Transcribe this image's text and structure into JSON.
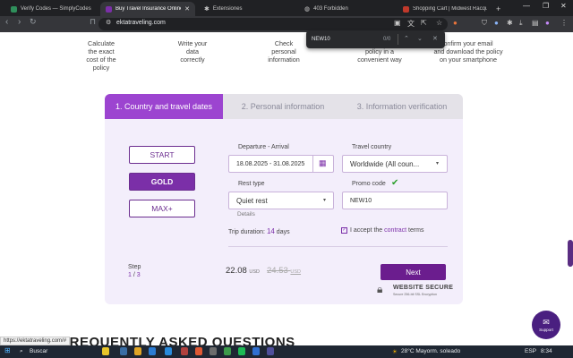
{
  "browser": {
    "tabs": [
      {
        "label": "Verify Codes — SimplyCodes",
        "icon_color": "#2f8f5b"
      },
      {
        "label": "Buy Travel Insurance Online | Ekt",
        "icon_color": "#7b2fa8"
      },
      {
        "label": "Extensiones",
        "icon_color": "#9aa0a6"
      },
      {
        "label": "403 Forbidden",
        "icon_color": "#9aa0a6"
      },
      {
        "label": "Shopping Cart | Midwest Racquet Sp",
        "icon_color": "#c0392b"
      }
    ],
    "new_tab": "+",
    "url": "ektatraveling.com",
    "find": {
      "query": "NEW10",
      "count": "0/0"
    }
  },
  "page": {
    "steps": [
      {
        "line1": "Calculate",
        "line2": "the exact",
        "line3": "cost of the",
        "line4": "policy"
      },
      {
        "line1": "Write your",
        "line2": "data",
        "line3": "correctly"
      },
      {
        "line1": "Check",
        "line2": "personal",
        "line3": "information"
      },
      {
        "line1": "policy in a",
        "line2": "convenient way"
      },
      {
        "line1": "onfirm your email",
        "line2": "and download the policy",
        "line3": "on your smartphone"
      }
    ],
    "form_tabs": [
      "1. Country and travel dates",
      "2. Personal information",
      "3. Information verification"
    ],
    "plans": [
      "START",
      "GOLD",
      "MAX+"
    ],
    "departure_label": "Departure - Arrival",
    "departure_value": "18.08.2025 - 31.08.2025",
    "country_label": "Travel country",
    "country_value": "Worldwide (All coun...",
    "rest_label": "Rest type",
    "rest_value": "Quiet rest",
    "details_link": "Details",
    "promo_label": "Promo code",
    "promo_value": "NEW10",
    "duration_label": "Trip duration:",
    "duration_value": "14",
    "duration_unit": "days",
    "accept_prefix": "I accept the",
    "accept_link": "contract",
    "accept_suffix": "terms",
    "step_label": "Step",
    "step_current": "1",
    "step_sep": "/",
    "step_total": "3",
    "price": "22.08",
    "price_currency": "USD",
    "old_price": "24.53",
    "old_price_currency": "USD",
    "next_button": "Next",
    "secure_title": "WEBSITE SECURE",
    "secure_sub": "Secure 256-bit SSL Encryption",
    "faq_heading": "FREQUENTLY ASKED QUESTIONS",
    "support_label": "Support",
    "status_url": "https://ektatraveling.com/#"
  },
  "taskbar": {
    "search_placeholder": "Buscar",
    "weather": "28°C  Mayorm. soleado",
    "lang": "ESP",
    "time": "8:34"
  },
  "colors": {
    "accent": "#9c44d0",
    "button": "#6b1d8e",
    "promo_ok": "#2ca02c"
  }
}
